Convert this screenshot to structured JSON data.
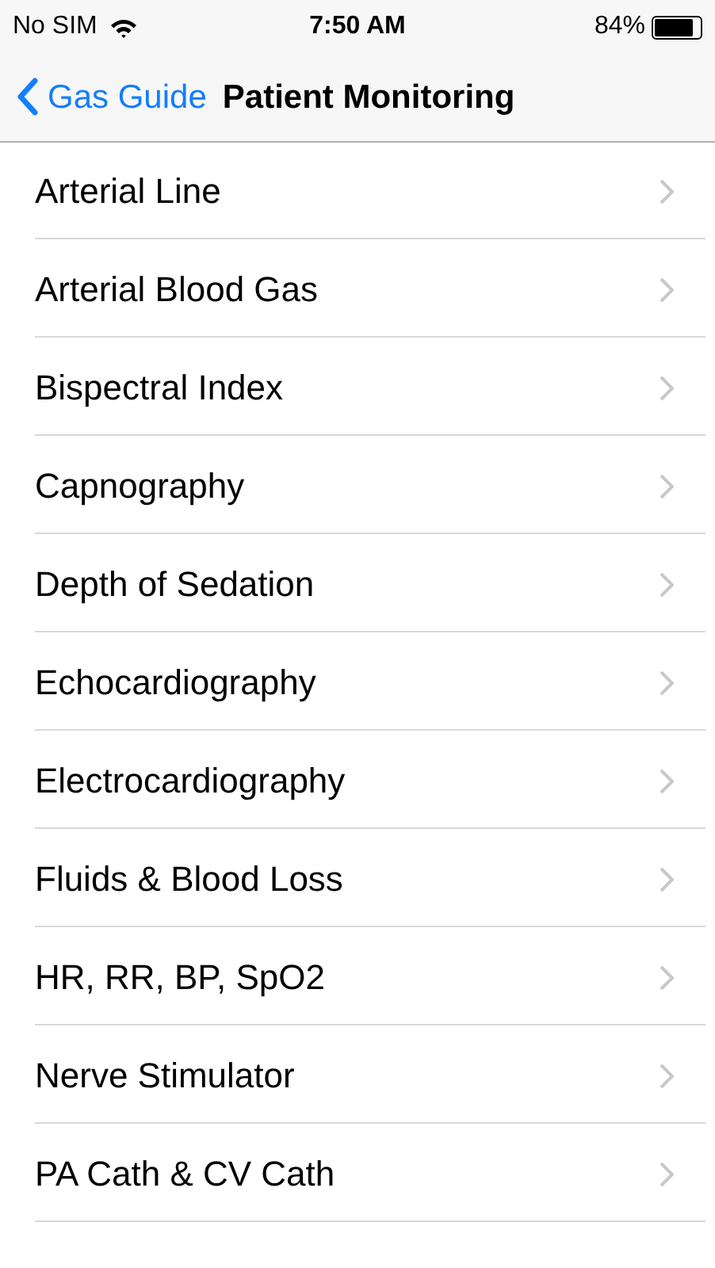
{
  "status_bar": {
    "carrier": "No SIM",
    "time": "7:50 AM",
    "battery": "84%"
  },
  "nav": {
    "back": "Gas Guide",
    "title": "Patient Monitoring"
  },
  "items": [
    {
      "label": "Arterial Line"
    },
    {
      "label": "Arterial Blood Gas"
    },
    {
      "label": "Bispectral Index"
    },
    {
      "label": "Capnography"
    },
    {
      "label": "Depth of Sedation"
    },
    {
      "label": "Echocardiography"
    },
    {
      "label": "Electrocardiography"
    },
    {
      "label": "Fluids & Blood Loss"
    },
    {
      "label": "HR, RR, BP, SpO2"
    },
    {
      "label": "Nerve Stimulator"
    },
    {
      "label": "PA Cath & CV Cath"
    }
  ]
}
